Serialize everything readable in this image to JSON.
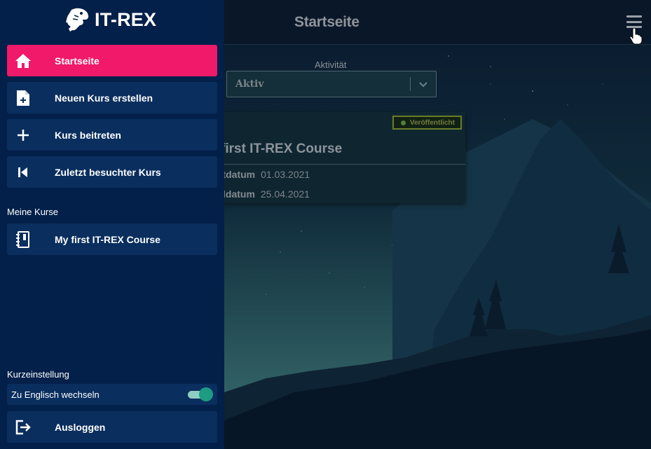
{
  "app": {
    "title": "Startseite",
    "logo_text": "IT-REX"
  },
  "filter": {
    "label": "Aktivität",
    "selected": "Aktiv"
  },
  "course_card": {
    "status": "Veröffentlicht",
    "title": "first IT-REX Course",
    "start_label": "rtdatum",
    "start_date": "01.03.2021",
    "end_label": "ldatum",
    "end_date": "25.04.2021"
  },
  "sidebar": {
    "items": [
      {
        "label": "Startseite",
        "icon": "home-icon",
        "active": true
      },
      {
        "label": "Neuen Kurs erstellen",
        "icon": "file-add-icon"
      },
      {
        "label": "Kurs beitreten",
        "icon": "plus-icon"
      },
      {
        "label": "Zuletzt besuchter Kurs",
        "icon": "skip-back-icon"
      }
    ],
    "my_courses_heading": "Meine Kurse",
    "courses": [
      {
        "label": "My first IT-REX Course",
        "icon": "notebook-icon"
      }
    ],
    "quick_settings_heading": "Kurzeinstellung",
    "language_toggle": {
      "label": "Zu Englisch wechseln",
      "on": true
    },
    "logout_label": "Ausloggen"
  },
  "colors": {
    "sidebar_bg": "#03204a",
    "nav_item_bg": "#0a2e5e",
    "accent_pink": "#f0196a",
    "toggle_green": "#1e9b83",
    "status_green": "#6a7d27"
  }
}
